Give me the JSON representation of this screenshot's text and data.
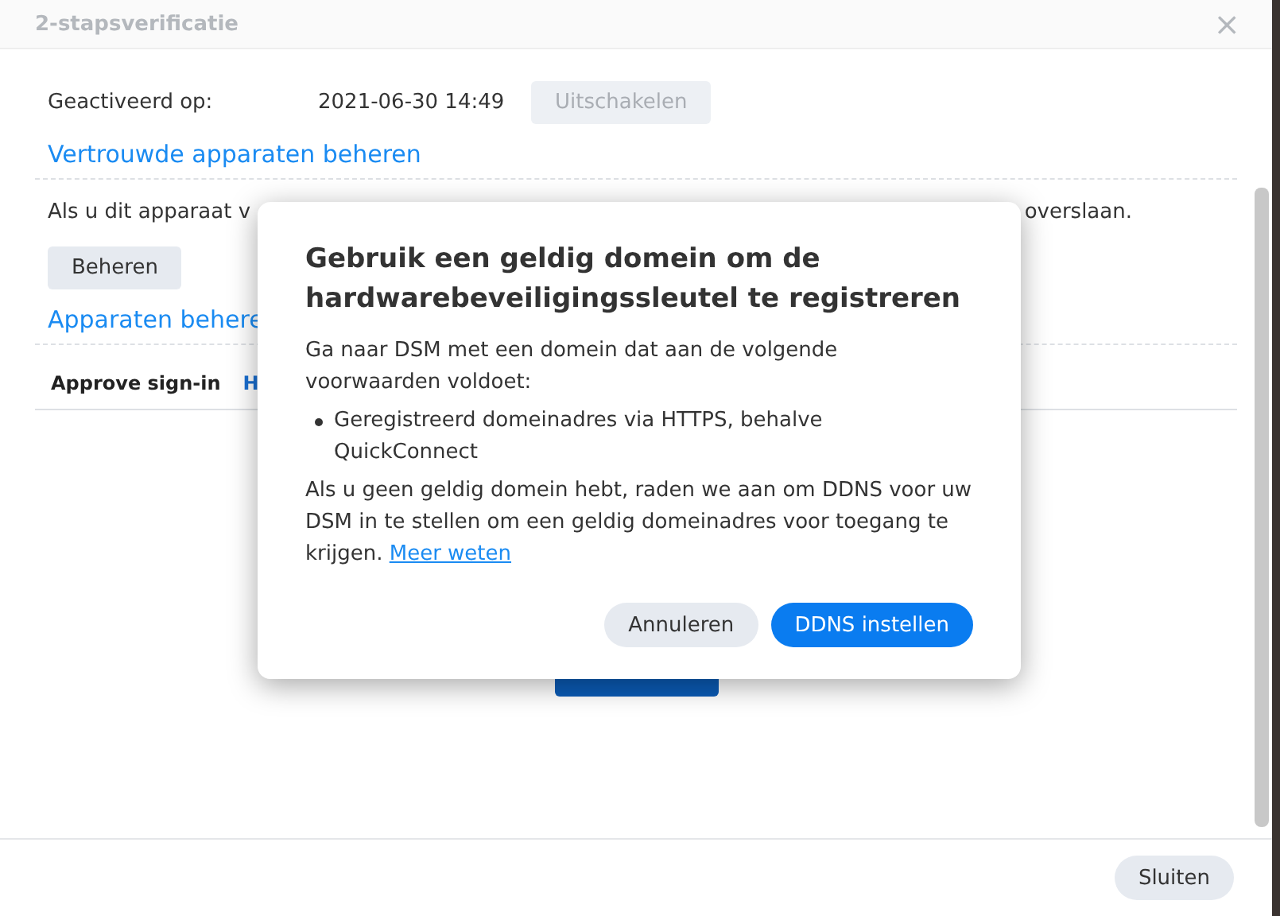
{
  "window": {
    "title": "2-stapsverificatie",
    "close": "×"
  },
  "activation": {
    "label": "Geactiveerd op:",
    "value": "2021-06-30 14:49",
    "button": {
      "label": "Uitschakelen",
      "disabled": true
    }
  },
  "trusted_devices": {
    "heading": "Vertrouwde apparaten beheren",
    "text_start": "Als u dit apparaat v",
    "text_end": "overslaan.",
    "button": "Beheren"
  },
  "devices": {
    "heading": "Apparaten behere",
    "tabs": [
      {
        "label": "Approve sign-in",
        "selected": true
      },
      {
        "label": "H",
        "selected": false
      }
    ]
  },
  "footer": {
    "button": "Sluiten"
  },
  "dialog": {
    "title": "Gebruik een geldig domein om de hardwarebeveiligingssleutel te registreren",
    "intro": "Ga naar DSM met een domein dat aan de volgende voorwaarden voldoet:",
    "bullets": [
      "Geregistreerd domeinadres via HTTPS, behalve QuickConnect"
    ],
    "note": "Als u geen geldig domein hebt, raden we aan om DDNS voor uw DSM in te stellen om een geldig domeinadres voor toegang te krijgen.",
    "link": "Meer weten",
    "buttons": [
      {
        "label": "Annuleren",
        "kind": "secondary"
      },
      {
        "label": "DDNS instellen",
        "kind": "primary"
      }
    ]
  }
}
